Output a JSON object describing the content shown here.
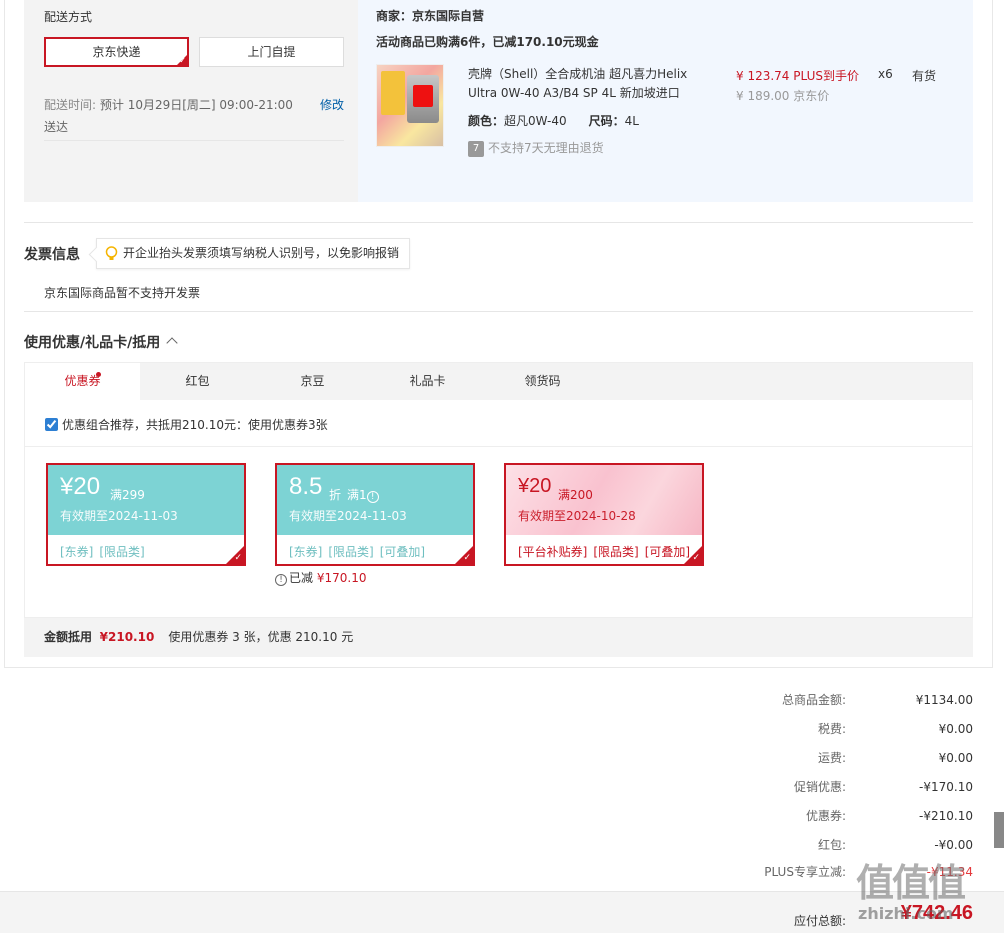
{
  "delivery": {
    "title": "配送方式",
    "options": [
      "京东快递",
      "上门自提"
    ],
    "time_label": "配送时间:",
    "time_value": "预计 10月29日[周二] 09:00-21:00 送达",
    "edit_label": "修改"
  },
  "order": {
    "merchant": "商家：京东国际自营",
    "promo": "活动商品已购满6件，已减170.10元现金",
    "product": {
      "name": "壳牌（Shell）全合成机油 超凡喜力Helix Ultra 0W-40 A3/B4 SP 4L 新加坡进口",
      "price": "¥ 123.74 PLUS到手价",
      "orig_price": "¥ 189.00 京东价",
      "qty": "x6",
      "stock": "有货",
      "color_label": "颜色：",
      "color_value": "超凡0W-40",
      "size_label": "尺码：",
      "size_value": "4L",
      "return_icon": "7",
      "return_note": "不支持7天无理由退货"
    }
  },
  "invoice": {
    "title": "发票信息",
    "tip": "开企业抬头发票须填写纳税人识别号，以免影响报销",
    "note": "京东国际商品暂不支持开发票"
  },
  "coupons": {
    "title": "使用优惠/礼品卡/抵用",
    "tabs": [
      "优惠券",
      "红包",
      "京豆",
      "礼品卡",
      "领货码"
    ],
    "combo_text": "优惠组合推荐，共抵用210.10元：使用优惠券3张",
    "items": [
      {
        "amount": "¥20",
        "cond": "满299",
        "valid": "有效期至2024-11-03",
        "tags": [
          "[东券]",
          "[限品类]"
        ]
      },
      {
        "amount": "8.5",
        "unit": "折",
        "cond": "满1",
        "valid": "有效期至2024-11-03",
        "tags": [
          "[东券]",
          "[限品类]",
          "[可叠加]"
        ]
      },
      {
        "amount": "¥20",
        "cond": "满200",
        "valid": "有效期至2024-10-28",
        "tags": [
          "[平台补贴券]",
          "[限品类]",
          "[可叠加]"
        ]
      }
    ],
    "used_label": "已减",
    "used_value": "¥170.10",
    "footer_label": "金额抵用",
    "footer_amount": "¥210.10",
    "footer_text": "使用优惠券 3 张，优惠 210.10 元"
  },
  "summary": {
    "rows": [
      {
        "label": "总商品金额:",
        "value": "¥1134.00"
      },
      {
        "label": "税费:",
        "value": "¥0.00"
      },
      {
        "label": "运费:",
        "value": "¥0.00"
      },
      {
        "label": "促销优惠:",
        "value": "-¥170.10"
      },
      {
        "label": "优惠券:",
        "value": "-¥210.10"
      },
      {
        "label": "红包:",
        "value": "-¥0.00"
      },
      {
        "label": "PLUS专享立减:",
        "value": "-¥11.34"
      }
    ],
    "total_label": "应付总额:",
    "total_value": "¥742.46"
  },
  "watermark": {
    "logo": "值值值",
    "text": "zhizhi.com"
  },
  "colors": {
    "brand_red": "#c81623",
    "coupon_teal": "#7dd3d4",
    "coupon_pink": "#f9c2cf",
    "link_blue": "#005ea7"
  }
}
